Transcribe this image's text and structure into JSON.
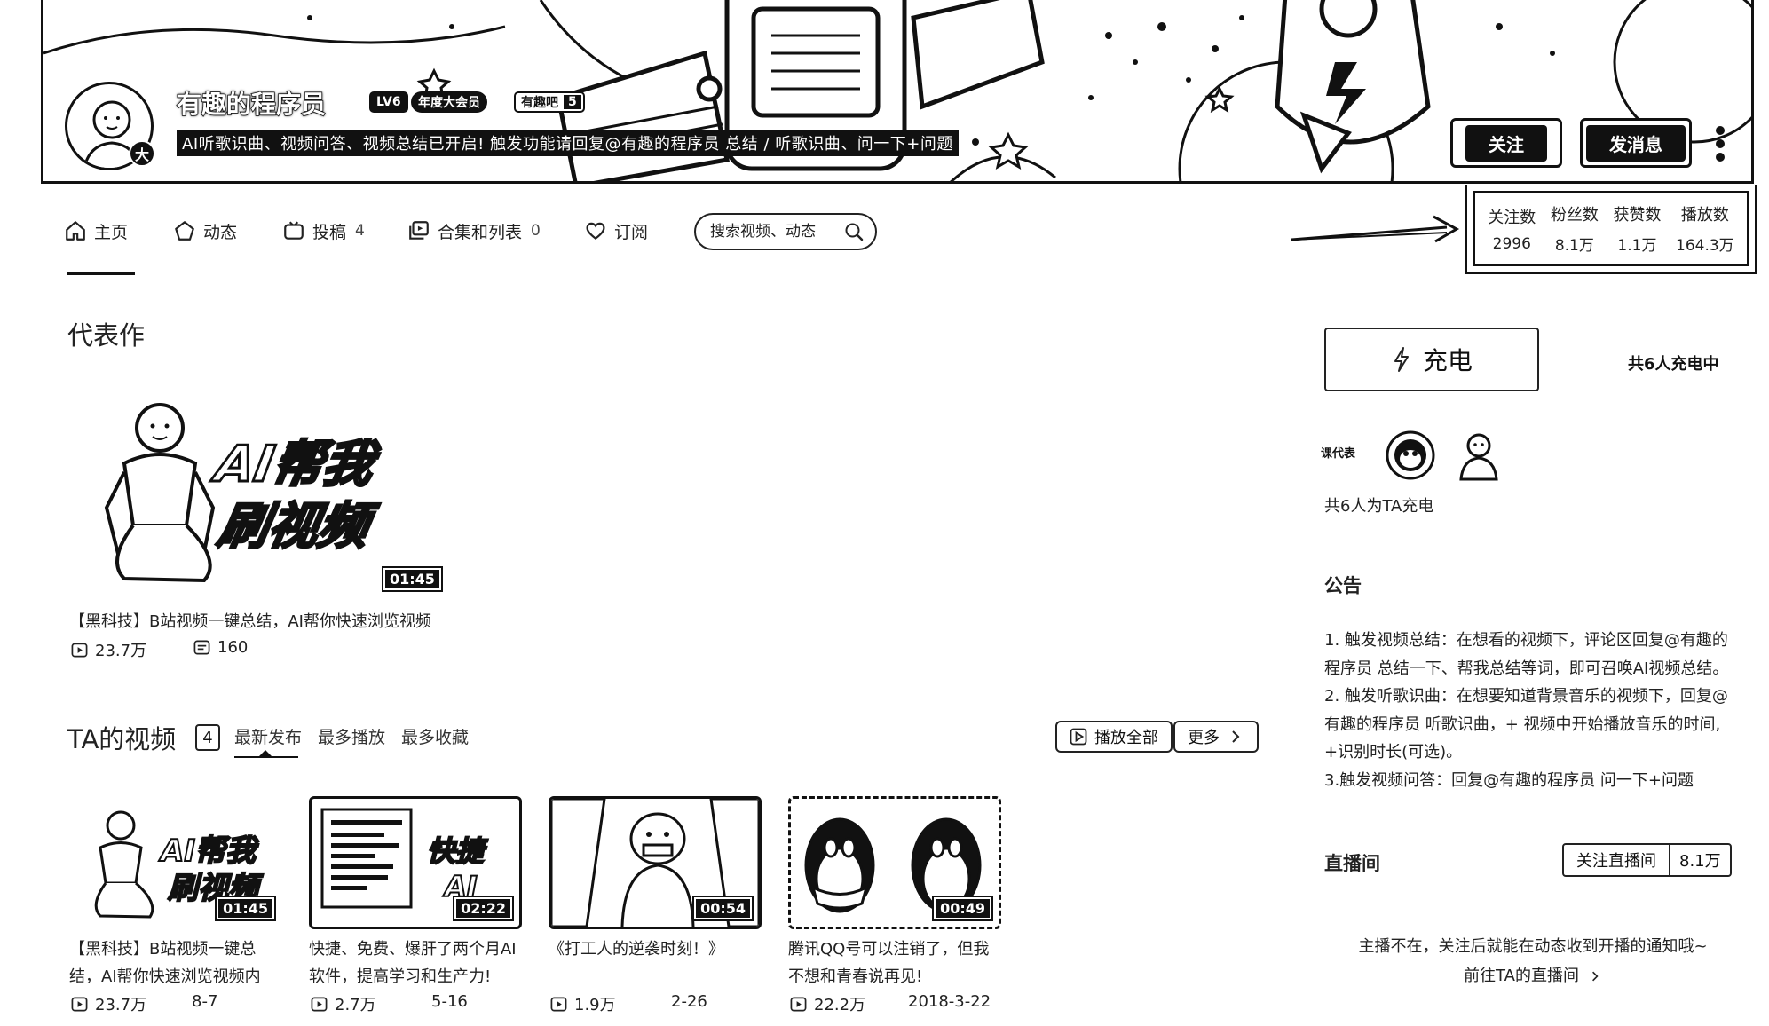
{
  "profile": {
    "name": "有趣的程序员",
    "level": "LV6",
    "vip_label": "年度大会员",
    "fan_badge": {
      "label": "有趣吧",
      "level": "5"
    },
    "sign": "AI听歌识曲、视频问答、视频总结已开启! 触发功能请回复@有趣的程序员 总结 / 听歌识曲、问一下+问题",
    "avatar_badge": "大"
  },
  "actions": {
    "follow": "关注",
    "message": "发消息"
  },
  "nav": {
    "items": [
      {
        "label": "主页",
        "count": ""
      },
      {
        "label": "动态",
        "count": ""
      },
      {
        "label": "投稿",
        "count": "4"
      },
      {
        "label": "合集和列表",
        "count": "0"
      },
      {
        "label": "订阅",
        "count": ""
      }
    ],
    "search_placeholder": "搜索视频、动态"
  },
  "stats": [
    {
      "label": "关注数",
      "value": "2996"
    },
    {
      "label": "粉丝数",
      "value": "8.1万"
    },
    {
      "label": "获赞数",
      "value": "1.1万"
    },
    {
      "label": "播放数",
      "value": "164.3万"
    }
  ],
  "masterpiece": {
    "heading": "代表作",
    "thumb_text": [
      "AI帮我",
      "刷视频"
    ],
    "duration": "01:45",
    "title": "【黑科技】B站视频一键总结，AI帮你快速浏览视频",
    "plays": "23.7万",
    "danmaku": "160"
  },
  "videos_section": {
    "heading": "TA的视频",
    "count": "4",
    "sort_tabs": [
      "最新发布",
      "最多播放",
      "最多收藏"
    ],
    "play_all": "播放全部",
    "more": "更多"
  },
  "videos": [
    {
      "title": "【黑科技】B站视频一键总结，AI帮你快速浏览视频内",
      "duration": "01:45",
      "plays": "23.7万",
      "date": "8-7",
      "thumb_text": [
        "AI帮我",
        "刷视频"
      ]
    },
    {
      "title": "快捷、免费、爆肝了两个月AI软件，提高学习和生产力!",
      "duration": "02:22",
      "plays": "2.7万",
      "date": "5-16",
      "thumb_text": [
        "快捷",
        "AI"
      ]
    },
    {
      "title": "《打工人的逆袭时刻！》",
      "duration": "00:54",
      "plays": "1.9万",
      "date": "2-26",
      "thumb_text": []
    },
    {
      "title": "腾讯QQ号可以注销了，但我不想和青春说再见!",
      "duration": "00:49",
      "plays": "22.2万",
      "date": "2018-3-22",
      "thumb_text": []
    }
  ],
  "sidebar": {
    "charge_label": "充电",
    "charge_count": "共6人充电中",
    "supporter_name": "课代表",
    "supporters_text": "共6人为TA充电",
    "notice_heading": "公告",
    "notice_lines": [
      "1. 触发视频总结：在想看的视频下，评论区回复@有趣的",
      "程序员 总结一下、帮我总结等词，即可召唤AI视频总结。",
      "2. 触发听歌识曲：在想要知道背景音乐的视频下，回复@",
      "有趣的程序员 听歌识曲，+ 视频中开始播放音乐的时间,",
      "+识别时长(可选)。",
      "3.触发视频问答：回复@有趣的程序员 问一下+问题"
    ],
    "live_heading": "直播间",
    "live_follow": "关注直播间",
    "live_count": "8.1万",
    "live_note": "主播不在，关注后就能在动态收到开播的通知哦~",
    "live_link": "前往TA的直播间"
  }
}
